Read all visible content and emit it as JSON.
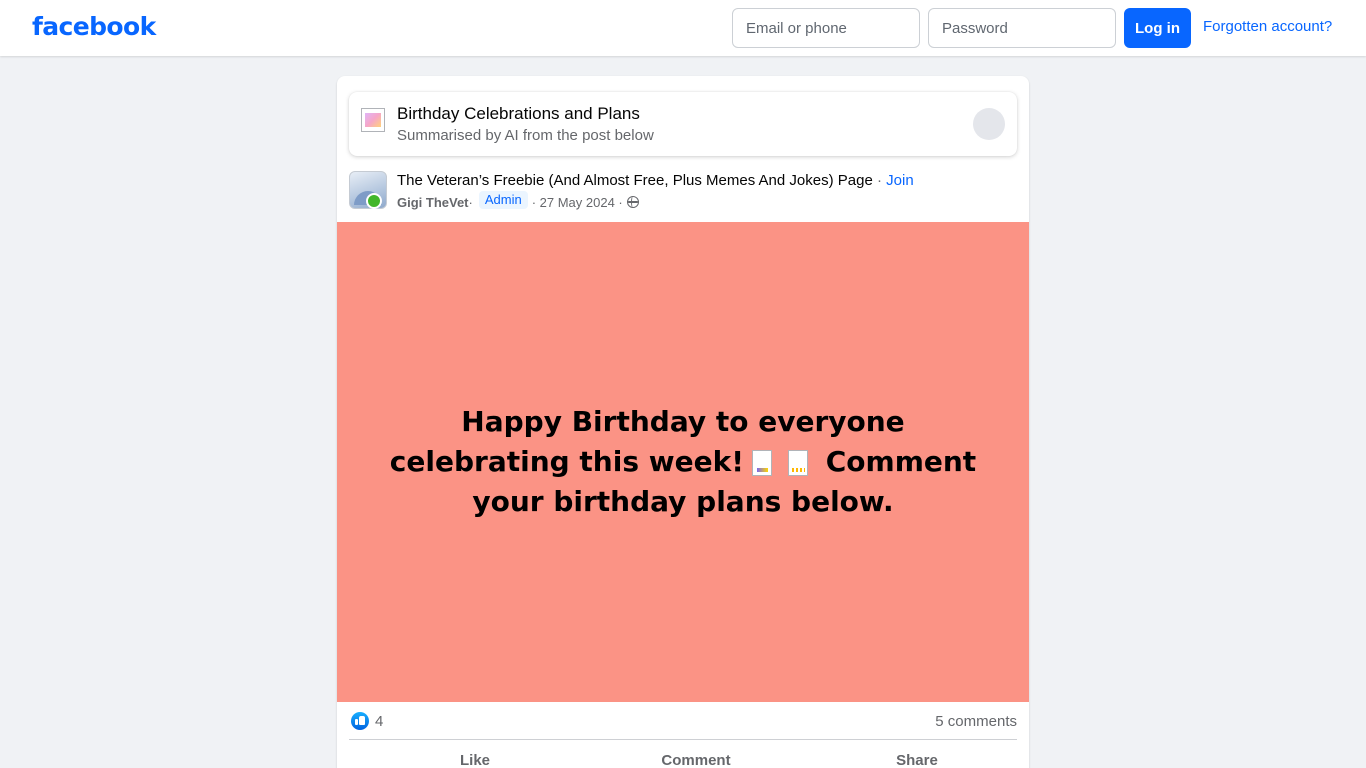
{
  "header": {
    "logo": "facebook",
    "email_placeholder": "Email or phone",
    "password_placeholder": "Password",
    "login_label": "Log in",
    "forgot_label": "Forgotten account?"
  },
  "ai_summary": {
    "title": "Birthday Celebrations and Plans",
    "subtitle": "Summarised by AI from the post below"
  },
  "post": {
    "group_name": "The Veteran’s Freebie (And Almost Free, Plus Memes And Jokes) Page",
    "separator": " · ",
    "join_label": "Join",
    "author": "Gigi TheVet",
    "author_sep": " ·",
    "role_badge": "Admin",
    "date": "· 27 May 2024 ·",
    "text_part1": "Happy Birthday to everyone celebrating this week!",
    "text_part2": "Comment your birthday plans below.",
    "background_color": "#fb9385",
    "reaction_count": "4",
    "comments_label": "5 comments",
    "like_label": "Like",
    "comment_label": "Comment",
    "share_label": "Share"
  },
  "colors": {
    "brand": "#0866ff",
    "page_bg": "#f0f2f5",
    "secondary_text": "#65676b"
  }
}
